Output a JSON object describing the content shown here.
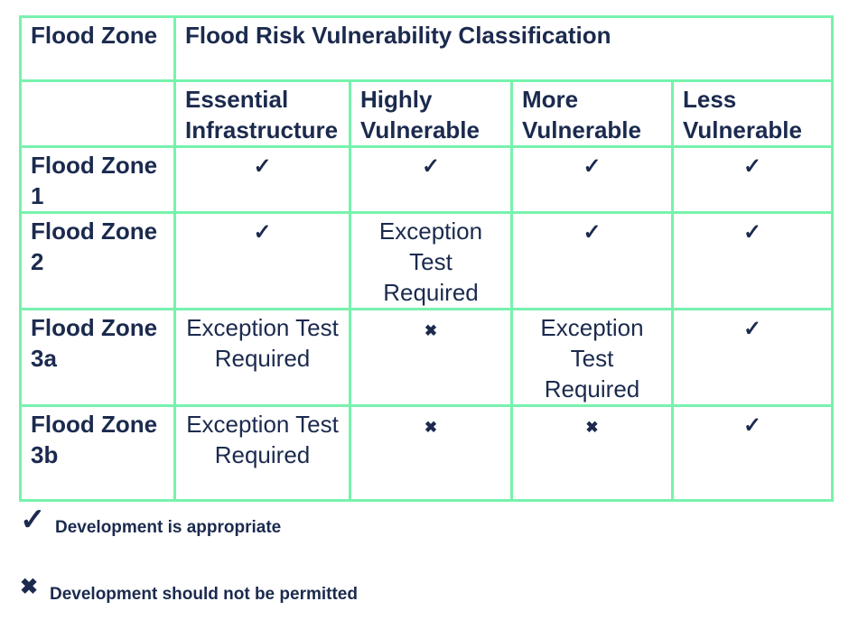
{
  "colors": {
    "border": "#77f2ac",
    "text": "#1b2a4e"
  },
  "table": {
    "corner_header": "Flood Zone",
    "group_header": "Flood Risk Vulnerability Classification",
    "columns": [
      "Essential Infrastructure",
      "Highly Vulnerable",
      "More Vulnerable",
      "Less Vulnerable"
    ],
    "rows": [
      {
        "zone": "Flood Zone 1",
        "cells": [
          "check",
          "check",
          "check",
          "check"
        ]
      },
      {
        "zone": "Flood Zone 2",
        "cells": [
          "check",
          "Exception Test Required",
          "check",
          "check"
        ]
      },
      {
        "zone": "Flood Zone 3a",
        "cells": [
          "Exception Test Required",
          "cross",
          "Exception Test Required",
          "check"
        ]
      },
      {
        "zone": "Flood Zone 3b",
        "cells": [
          "Exception Test Required",
          "cross",
          "cross",
          "check"
        ]
      }
    ]
  },
  "symbols": {
    "check": "✓",
    "cross": "✖"
  },
  "legend": [
    {
      "icon": "check",
      "label": "Development is appropriate"
    },
    {
      "icon": "cross",
      "label": "Development should not be permitted"
    }
  ]
}
